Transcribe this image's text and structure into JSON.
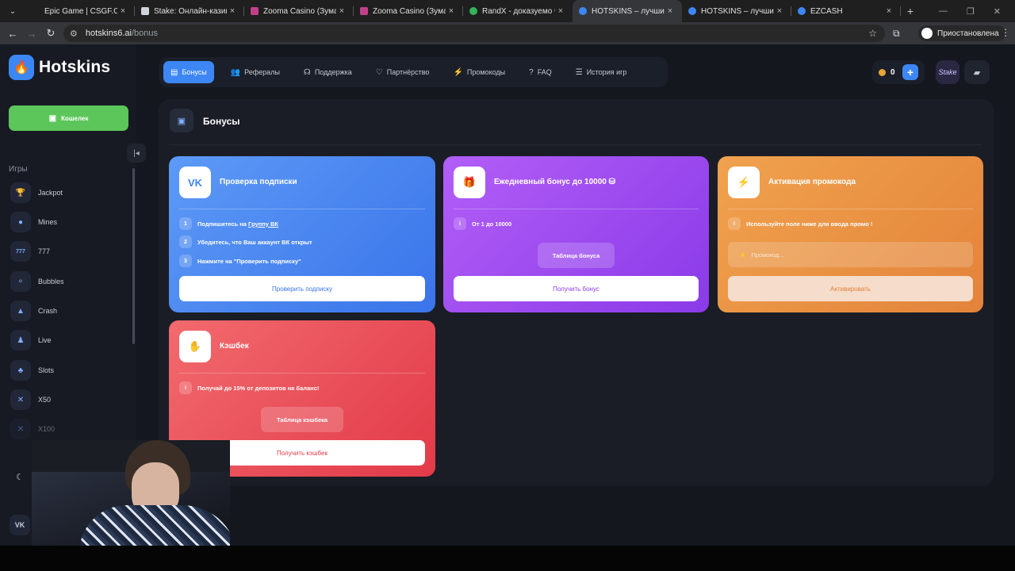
{
  "browser": {
    "tabs": [
      {
        "title": "Epic Game | CSGF.CC",
        "active": false,
        "favicon_color": "#1f1f1f"
      },
      {
        "title": "Stake: Онлайн-казино и",
        "active": false,
        "favicon_color": "#cfd3da"
      },
      {
        "title": "Zooma Casino (Зума Казі",
        "active": false,
        "favicon_color": "#c2408a"
      },
      {
        "title": "Zooma Casino (Зума Казі",
        "active": false,
        "favicon_color": "#c2408a"
      },
      {
        "title": "RandX - доказуемо чест",
        "active": false,
        "favicon_color": "#33b35a"
      },
      {
        "title": "HOTSKINS – лучшие выі",
        "active": true,
        "favicon_color": "#3d87f5"
      },
      {
        "title": "HOTSKINS – лучшие выі",
        "active": false,
        "favicon_color": "#3d87f5"
      },
      {
        "title": "EZCASH",
        "active": false,
        "favicon_color": "#3d87f5"
      }
    ],
    "url_host": "hotskins6.ai",
    "url_path": "/bonus",
    "profile_label": "Приостановлена"
  },
  "site": {
    "brand": "Hotskins",
    "wallet_label": "Кошелек",
    "games_heading": "Игры",
    "games": [
      {
        "label": "Jackpot",
        "icon": "trophy-icon"
      },
      {
        "label": "Mines",
        "icon": "bomb-icon"
      },
      {
        "label": "777",
        "icon": "slot-777-icon"
      },
      {
        "label": "Bubbles",
        "icon": "bubbles-icon"
      },
      {
        "label": "Crash",
        "icon": "rocket-icon"
      },
      {
        "label": "Live",
        "icon": "live-dealer-icon"
      },
      {
        "label": "Slots",
        "icon": "cherries-icon"
      },
      {
        "label": "X50",
        "icon": "wheel-x50-icon"
      },
      {
        "label": "X100",
        "icon": "wheel-x100-icon"
      }
    ],
    "nav": [
      {
        "label": "Бонусы",
        "icon": "gift-icon",
        "active": true
      },
      {
        "label": "Рефералы",
        "icon": "users-icon",
        "active": false
      },
      {
        "label": "Поддержка",
        "icon": "headset-icon",
        "active": false
      },
      {
        "label": "Партнёрство",
        "icon": "handshake-icon",
        "active": false
      },
      {
        "label": "Промокоды",
        "icon": "bolt-icon",
        "active": false
      },
      {
        "label": "FAQ",
        "icon": "question-icon",
        "active": false
      },
      {
        "label": "История игр",
        "icon": "history-icon",
        "active": false
      }
    ],
    "balance": "0",
    "avatar_text": "Stake",
    "page_title": "Бонусы",
    "accent_color": "#3d87f5",
    "wallet_color": "#5cc65a"
  },
  "cards": {
    "subscribe": {
      "title": "Проверка подписки",
      "icon_text": "VK",
      "steps": [
        {
          "num": "1",
          "text": "Подпишитесь на ",
          "link": "Группу ВК"
        },
        {
          "num": "2",
          "text": "Убедитесь, что Ваш аккаунт ВК открыт",
          "link": ""
        },
        {
          "num": "3",
          "text": "Нажмите на \"Проверить подписку\"",
          "link": ""
        }
      ],
      "button": "Проверить подписку",
      "color": "#4c8cf2"
    },
    "daily": {
      "title": "Ежедневный бонус до 10000",
      "info": "От 1 до 10000",
      "table_button": "Таблица бонуса",
      "button": "Получить бонус",
      "color": "#9a48f0"
    },
    "promo": {
      "title": "Активация промокода",
      "info": "Используйте поле ниже для ввода промо !",
      "placeholder": "Промокод...",
      "button": "Активировать",
      "color": "#e8923e"
    },
    "cashback": {
      "title": "Кэшбек",
      "info": "Получай до 15% от депозитов на баланс!",
      "table_button": "Таблица кэшбека",
      "button": "Получить кэшбек",
      "color": "#e84a55"
    }
  }
}
